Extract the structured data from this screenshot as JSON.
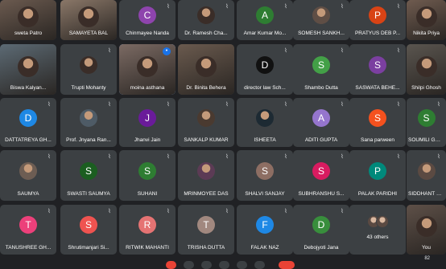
{
  "participants": [
    {
      "name": "sweta Patro",
      "kind": "video",
      "color": "#6b5a4f"
    },
    {
      "name": "SAMAYETA BAL",
      "kind": "video",
      "color": "#8a7768"
    },
    {
      "name": "Chinmayee Nanda",
      "kind": "avatar",
      "initial": "C",
      "color": "#8e44ad"
    },
    {
      "name": "Dr. Ramesh Cha...",
      "kind": "photo",
      "color": "#3a2d28"
    },
    {
      "name": "Amar Kumar Mo...",
      "kind": "avatar",
      "initial": "A",
      "color": "#2e7d32"
    },
    {
      "name": "SOMESH SANKH...",
      "kind": "photo",
      "color": "#5f4e45"
    },
    {
      "name": "PRATYUS DEB P...",
      "kind": "avatar",
      "initial": "P",
      "color": "#d84315"
    },
    {
      "name": "Nikita Priya",
      "kind": "video",
      "color": "#6f5b4f"
    },
    {
      "name": "Biswa Kalyan...",
      "kind": "video",
      "color": "#5c6a74"
    },
    {
      "name": "Trupti Mohanty",
      "kind": "photo",
      "color": "#3a2d28"
    },
    {
      "name": "moina asthana",
      "kind": "video",
      "color": "#7b6a63",
      "active": true
    },
    {
      "name": "Dr. Binita Behera",
      "kind": "video",
      "color": "#6a5a4e"
    },
    {
      "name": "director law Sch...",
      "kind": "avatar",
      "initial": "D",
      "color": "#111111"
    },
    {
      "name": "Shambo Dutta",
      "kind": "avatar",
      "initial": "S",
      "color": "#43a047"
    },
    {
      "name": "SASWATA BEHE...",
      "kind": "avatar",
      "initial": "S",
      "color": "#7b3fa0"
    },
    {
      "name": "Shilpi Ghosh",
      "kind": "video",
      "color": "#5a554f"
    },
    {
      "name": "DATTATREYA GH...",
      "kind": "avatar",
      "initial": "D",
      "color": "#1e88e5"
    },
    {
      "name": "Prof. Jnyana Ran...",
      "kind": "photo",
      "color": "#4e5b66"
    },
    {
      "name": "Jhanvi Jain",
      "kind": "avatar",
      "initial": "J",
      "color": "#6a1b9a"
    },
    {
      "name": "SANKALP KUMAR",
      "kind": "photo",
      "color": "#4a3a30"
    },
    {
      "name": "ISHEETA",
      "kind": "photo",
      "color": "#1d2a33"
    },
    {
      "name": "ADITI GUPTA",
      "kind": "avatar",
      "initial": "A",
      "color": "#9575cd"
    },
    {
      "name": "Sana parween",
      "kind": "avatar",
      "initial": "S",
      "color": "#f4511e"
    },
    {
      "name": "SOUMILI GOS...",
      "kind": "avatar",
      "initial": "S",
      "color": "#2e7d32"
    },
    {
      "name": "SAUMYA",
      "kind": "photo",
      "color": "#6d5d53"
    },
    {
      "name": "SWASTI SAUMYA",
      "kind": "avatar",
      "initial": "S",
      "color": "#1b5e20"
    },
    {
      "name": "SUHANI",
      "kind": "avatar",
      "initial": "S",
      "color": "#2e7d32"
    },
    {
      "name": "MRINMOYEE DAS",
      "kind": "photo",
      "color": "#5c3b55"
    },
    {
      "name": "SHALVI SANJAY",
      "kind": "avatar",
      "initial": "S",
      "color": "#8d6e63"
    },
    {
      "name": "SUBHRANSHU S...",
      "kind": "avatar",
      "initial": "S",
      "color": "#d81b60"
    },
    {
      "name": "PALAK PARIDHI",
      "kind": "avatar",
      "initial": "P",
      "color": "#00897b"
    },
    {
      "name": "SIDDHANT MI...",
      "kind": "photo",
      "color": "#5b4a42"
    },
    {
      "name": "TANUSHREE GH...",
      "kind": "avatar",
      "initial": "T",
      "color": "#ec407a"
    },
    {
      "name": "Shrutimanjari Si...",
      "kind": "avatar",
      "initial": "S",
      "color": "#ef5350"
    },
    {
      "name": "RITWIK MAHANTI",
      "kind": "avatar",
      "initial": "R",
      "color": "#e57373"
    },
    {
      "name": "TRISHA DUTTA",
      "kind": "avatar",
      "initial": "T",
      "color": "#a1887f"
    },
    {
      "name": "FALAK NAZ",
      "kind": "avatar",
      "initial": "F",
      "color": "#1e88e5"
    },
    {
      "name": "Debojyoti Jana",
      "kind": "avatar",
      "initial": "D",
      "color": "#388e3c"
    },
    {
      "name": "43 others",
      "kind": "others",
      "color": "#3c4043"
    },
    {
      "name": "You",
      "kind": "video",
      "color": "#5e5048"
    }
  ],
  "controls": {
    "participants_count": "82",
    "icons": [
      "mic-icon",
      "camera-icon",
      "captions-icon",
      "present-icon",
      "raise-hand-icon",
      "more-icon",
      "end-call-icon"
    ]
  }
}
